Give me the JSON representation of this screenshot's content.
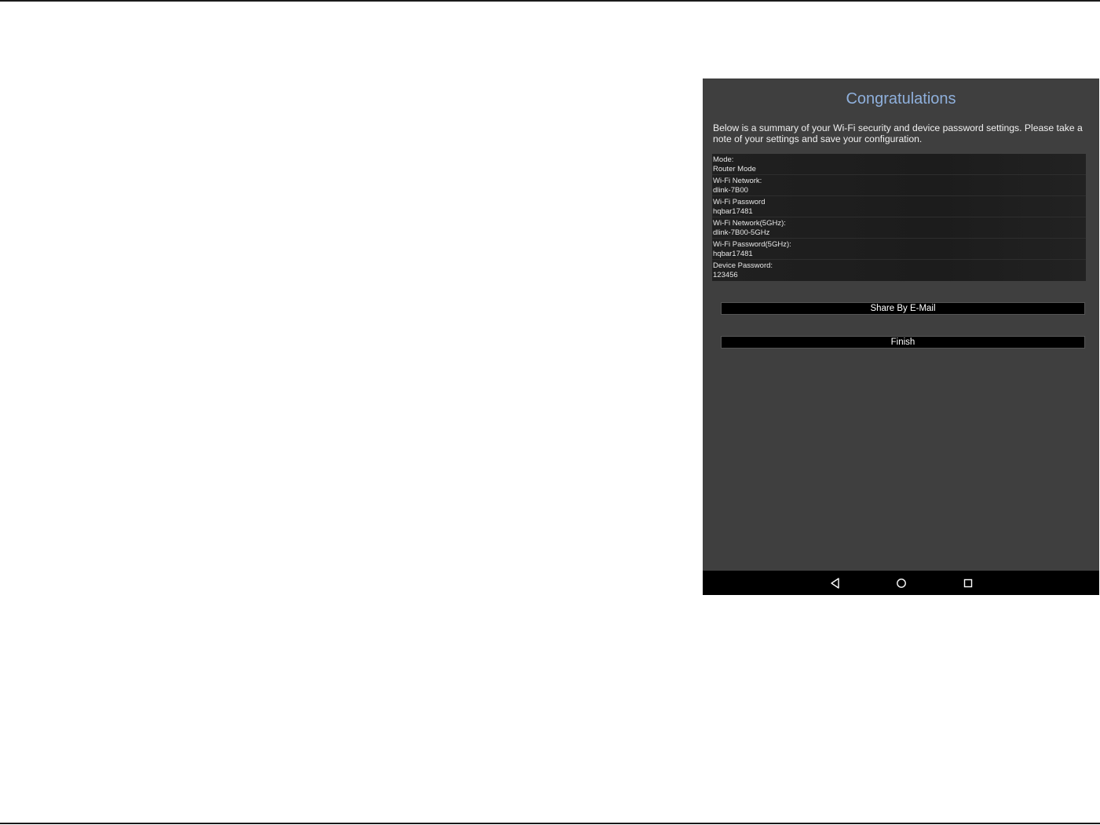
{
  "screen": {
    "title": "Congratulations",
    "intro": "Below is a summary of your Wi-Fi security and device password settings. Please take a note of your settings and save your configuration."
  },
  "summary": {
    "rows": [
      {
        "label": "Mode:",
        "value": "Router Mode"
      },
      {
        "label": "Wi-Fi Network:",
        "value": "dlink-7B00"
      },
      {
        "label": "Wi-Fi Password",
        "value": "hqbar17481"
      },
      {
        "label": "Wi-Fi Network(5GHz):",
        "value": "dlink-7B00-5GHz"
      },
      {
        "label": "Wi-Fi Password(5GHz):",
        "value": "hqbar17481"
      },
      {
        "label": "Device Password:",
        "value": "123456"
      }
    ]
  },
  "buttons": {
    "share_label": "Share By E-Mail",
    "finish_label": "Finish"
  },
  "navbar": {
    "icons": [
      "back-icon",
      "home-icon",
      "recent-apps-icon"
    ]
  },
  "colors": {
    "title": "#8fb0dc",
    "screen_background": "#3f3f3f",
    "summary_background": "#1e1e1e",
    "button_background": "#000000",
    "navbar_background": "#000000"
  }
}
